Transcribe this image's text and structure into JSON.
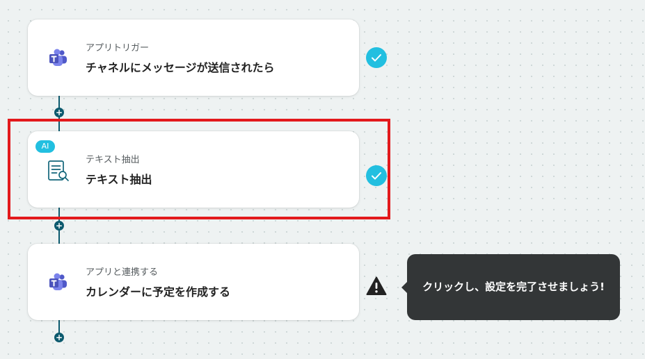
{
  "flow": {
    "steps": [
      {
        "kind": "アプリトリガー",
        "title": "チャネルにメッセージが送信されたら",
        "icon": "teams-icon",
        "status": "complete"
      },
      {
        "badge": "AI",
        "kind": "テキスト抽出",
        "title": "テキスト抽出",
        "icon": "document-search-icon",
        "status": "complete"
      },
      {
        "kind": "アプリと連携する",
        "title": "カレンダーに予定を作成する",
        "icon": "teams-icon",
        "status": "warning"
      }
    ],
    "tooltip": "クリックし、設定を完了させましょう!"
  },
  "colors": {
    "connector": "#0c5a6e",
    "check": "#22bfe0",
    "highlight": "#e3191c",
    "teams": "#5059c9"
  }
}
